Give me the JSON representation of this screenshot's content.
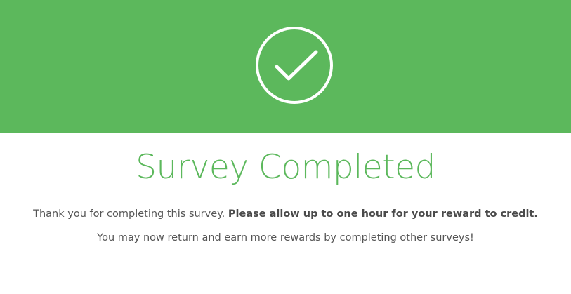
{
  "banner": {
    "color": "#5cb85c",
    "icon": "check-circle-icon"
  },
  "main": {
    "title": "Survey Completed",
    "title_color": "#5cb85c",
    "message_intro": "Thank you for completing this survey.",
    "message_emphasis": "Please allow up to one hour for your reward to credit.",
    "message_followup": "You may now return and earn more rewards by completing other surveys!"
  }
}
